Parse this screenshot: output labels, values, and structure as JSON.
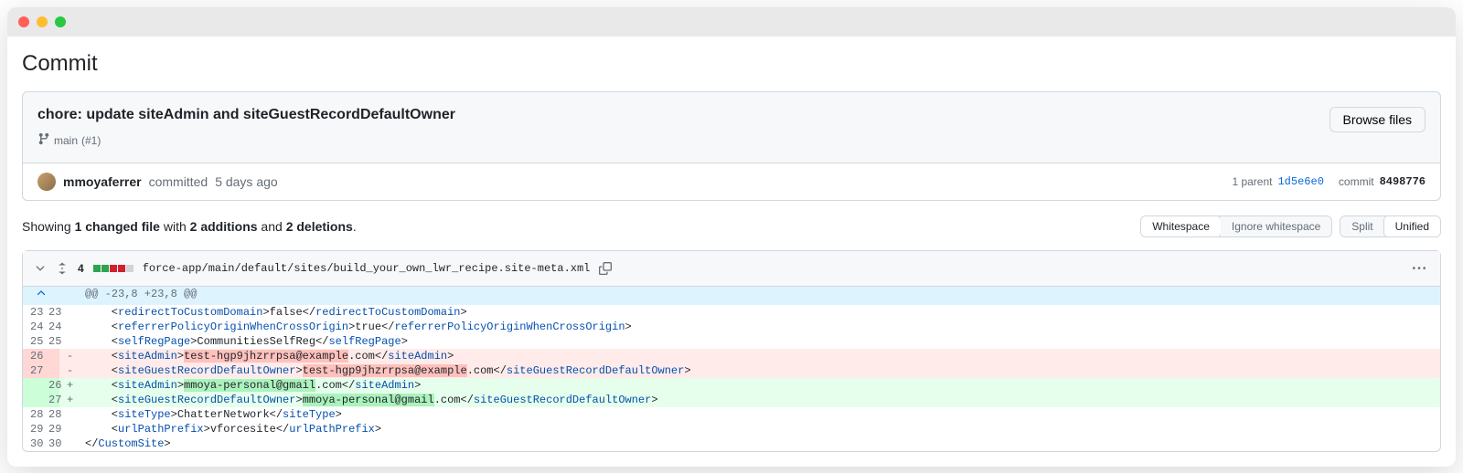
{
  "page_title": "Commit",
  "commit": {
    "title": "chore: update siteAdmin and siteGuestRecordDefaultOwner",
    "branch": "main",
    "branch_meta": "(#1)",
    "browse_files_label": "Browse files",
    "author": "mmoyaferrer",
    "action_text": "committed",
    "time": "5 days ago",
    "parent_label": "1 parent",
    "parent_sha": "1d5e6e0",
    "commit_label": "commit",
    "sha": "8498776"
  },
  "stats": {
    "prefix": "Showing ",
    "files": "1 changed file",
    "mid1": " with ",
    "additions": "2 additions",
    "mid2": " and ",
    "deletions": "2 deletions"
  },
  "toggles": {
    "ws1": "Whitespace",
    "ws2": "Ignore whitespace",
    "v1": "Split",
    "v2": "Unified"
  },
  "file": {
    "count": "4",
    "path": "force-app/main/default/sites/build_your_own_lwr_recipe.site-meta.xml",
    "hunk": "@@ -23,8 +23,8 @@"
  },
  "diff": {
    "old_email": "test-hgp9jhzrrpsa@example",
    "new_email": "mmoya-personal@gmail",
    "com": ".com"
  },
  "lines": {
    "l23": "23",
    "l24": "24",
    "l25": "25",
    "l26": "26",
    "l27": "27",
    "l28": "28",
    "l29": "29",
    "l30": "30",
    "r23": "23",
    "r24": "24",
    "r25": "25",
    "r26": "26",
    "r27": "27",
    "r28": "28",
    "r29": "29",
    "r30": "30"
  }
}
